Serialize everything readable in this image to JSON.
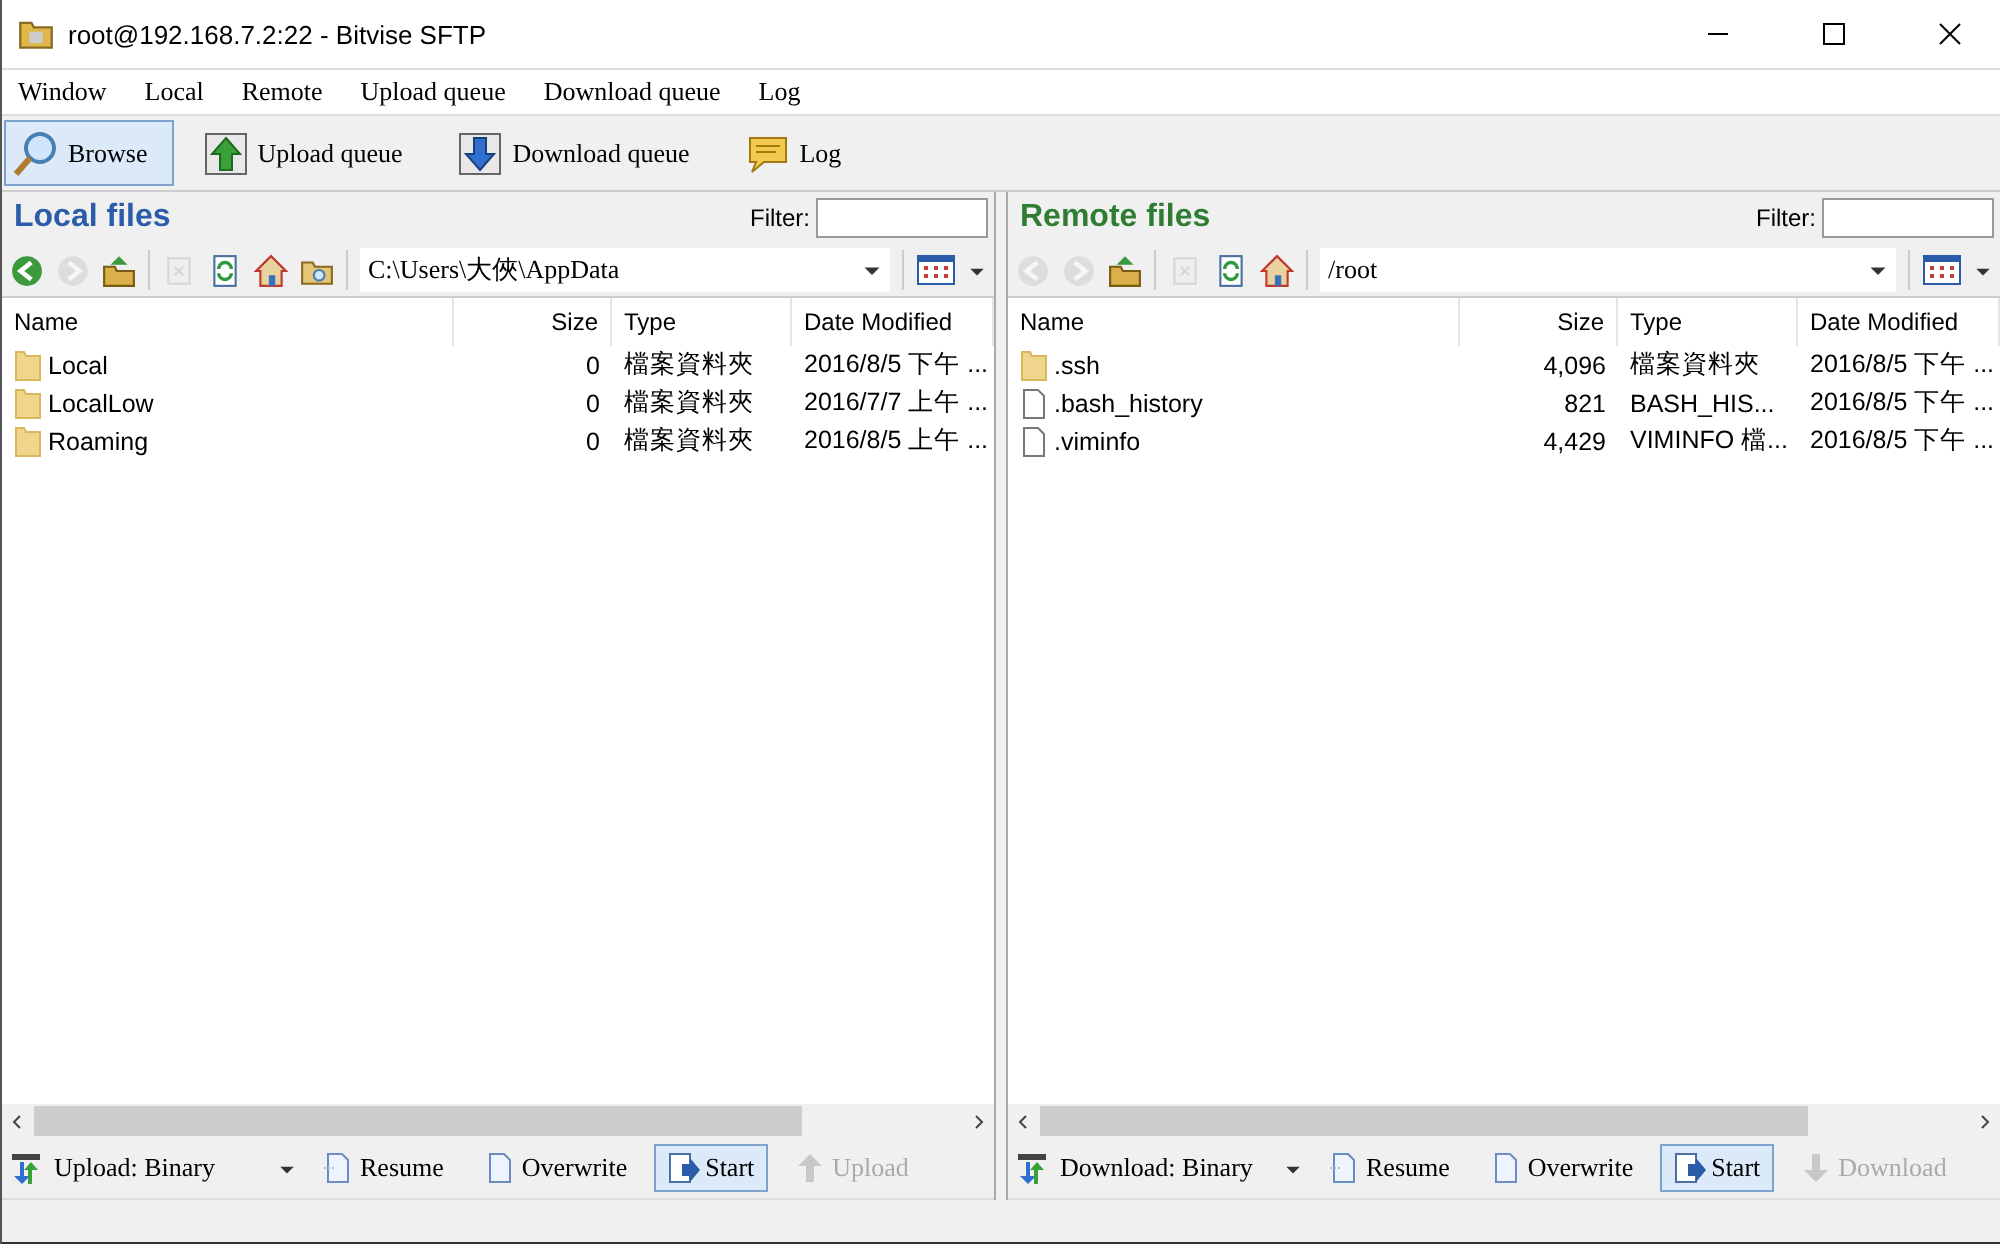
{
  "window": {
    "title": "root@192.168.7.2:22 - Bitvise SFTP"
  },
  "menu": [
    "Window",
    "Local",
    "Remote",
    "Upload queue",
    "Download queue",
    "Log"
  ],
  "toolbar": [
    {
      "label": "Browse",
      "kind": "browse",
      "selected": true
    },
    {
      "label": "Upload queue",
      "kind": "upload",
      "selected": false
    },
    {
      "label": "Download queue",
      "kind": "download",
      "selected": false
    },
    {
      "label": "Log",
      "kind": "log",
      "selected": false
    }
  ],
  "panels": [
    {
      "title": "Local files",
      "color": "#2a5caa",
      "filter_label": "Filter:",
      "path": "C:\\Users\\大俠\\AppData",
      "nav": [
        {
          "kind": "back",
          "disabled": false
        },
        {
          "kind": "forward",
          "disabled": true
        },
        {
          "kind": "up",
          "disabled": false
        },
        {
          "kind": "delete",
          "disabled": true
        },
        {
          "kind": "refresh",
          "disabled": false
        },
        {
          "kind": "home",
          "disabled": false
        },
        {
          "kind": "folder",
          "disabled": false
        }
      ],
      "columns": [
        "Name",
        "Size",
        "Type",
        "Date Modified"
      ],
      "rows": [
        {
          "kind": "folder",
          "name": "Local",
          "size": "0",
          "type": "檔案資料夾",
          "date": "2016/8/5 下午 ..."
        },
        {
          "kind": "folder",
          "name": "LocalLow",
          "size": "0",
          "type": "檔案資料夾",
          "date": "2016/7/7 上午 ..."
        },
        {
          "kind": "folder",
          "name": "Roaming",
          "size": "0",
          "type": "檔案資料夾",
          "date": "2016/8/5 上午 ..."
        }
      ],
      "transfer": {
        "mode": "Upload: Binary",
        "buttons": [
          {
            "kind": "resume",
            "label": "Resume",
            "on": false,
            "disabled": false
          },
          {
            "kind": "overwrite",
            "label": "Overwrite",
            "on": false,
            "disabled": false
          },
          {
            "kind": "start",
            "label": "Start",
            "on": true,
            "disabled": false
          },
          {
            "kind": "upload",
            "label": "Upload",
            "on": false,
            "disabled": true
          }
        ]
      }
    },
    {
      "title": "Remote files",
      "color": "#2e7d32",
      "filter_label": "Filter:",
      "path": "/root",
      "nav": [
        {
          "kind": "back",
          "disabled": true
        },
        {
          "kind": "forward",
          "disabled": true
        },
        {
          "kind": "up",
          "disabled": false
        },
        {
          "kind": "delete",
          "disabled": true
        },
        {
          "kind": "refresh",
          "disabled": false
        },
        {
          "kind": "home",
          "disabled": false
        }
      ],
      "columns": [
        "Name",
        "Size",
        "Type",
        "Date Modified"
      ],
      "rows": [
        {
          "kind": "folder",
          "name": ".ssh",
          "size": "4,096",
          "type": "檔案資料夾",
          "date": "2016/8/5 下午 ..."
        },
        {
          "kind": "file",
          "name": ".bash_history",
          "size": "821",
          "type": "BASH_HIS...",
          "date": "2016/8/5 下午 ..."
        },
        {
          "kind": "file",
          "name": ".viminfo",
          "size": "4,429",
          "type": "VIMINFO 檔...",
          "date": "2016/8/5 下午 ..."
        }
      ],
      "transfer": {
        "mode": "Download: Binary",
        "buttons": [
          {
            "kind": "resume",
            "label": "Resume",
            "on": false,
            "disabled": false
          },
          {
            "kind": "overwrite",
            "label": "Overwrite",
            "on": false,
            "disabled": false
          },
          {
            "kind": "start",
            "label": "Start",
            "on": true,
            "disabled": false
          },
          {
            "kind": "download",
            "label": "Download",
            "on": false,
            "disabled": true
          }
        ]
      }
    }
  ]
}
